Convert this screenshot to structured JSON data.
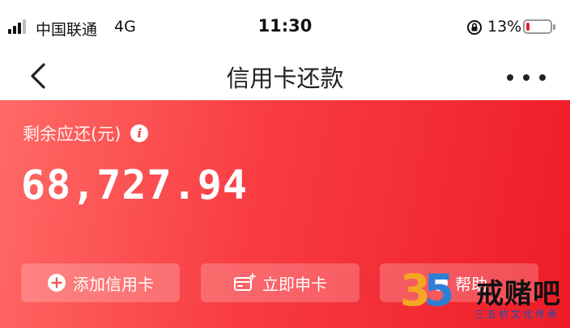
{
  "status_bar": {
    "carrier": "中国联通",
    "network": "4G",
    "time": "11:30",
    "battery_percent": "13%",
    "battery_level": 0.13,
    "icons": [
      "signal-icon",
      "rotation-lock-icon",
      "battery-icon"
    ]
  },
  "nav": {
    "title": "信用卡还款",
    "back_icon": "chevron-left-icon",
    "more_icon": "more-dots-icon"
  },
  "balance": {
    "label": "剩余应还(元)",
    "amount": "68,727.94",
    "info_icon": "info-icon"
  },
  "actions": {
    "add_card": "添加信用卡",
    "apply_card": "立即申卡",
    "help": "帮助"
  },
  "watermark": {
    "digits_3": "3",
    "digits_5": "5",
    "brand": "戒赌吧",
    "slogan": "三五杭文化传承"
  },
  "colors": {
    "hero_start": "#ff6a66",
    "hero_end": "#ee1c27",
    "battery_low": "#e3222b"
  }
}
